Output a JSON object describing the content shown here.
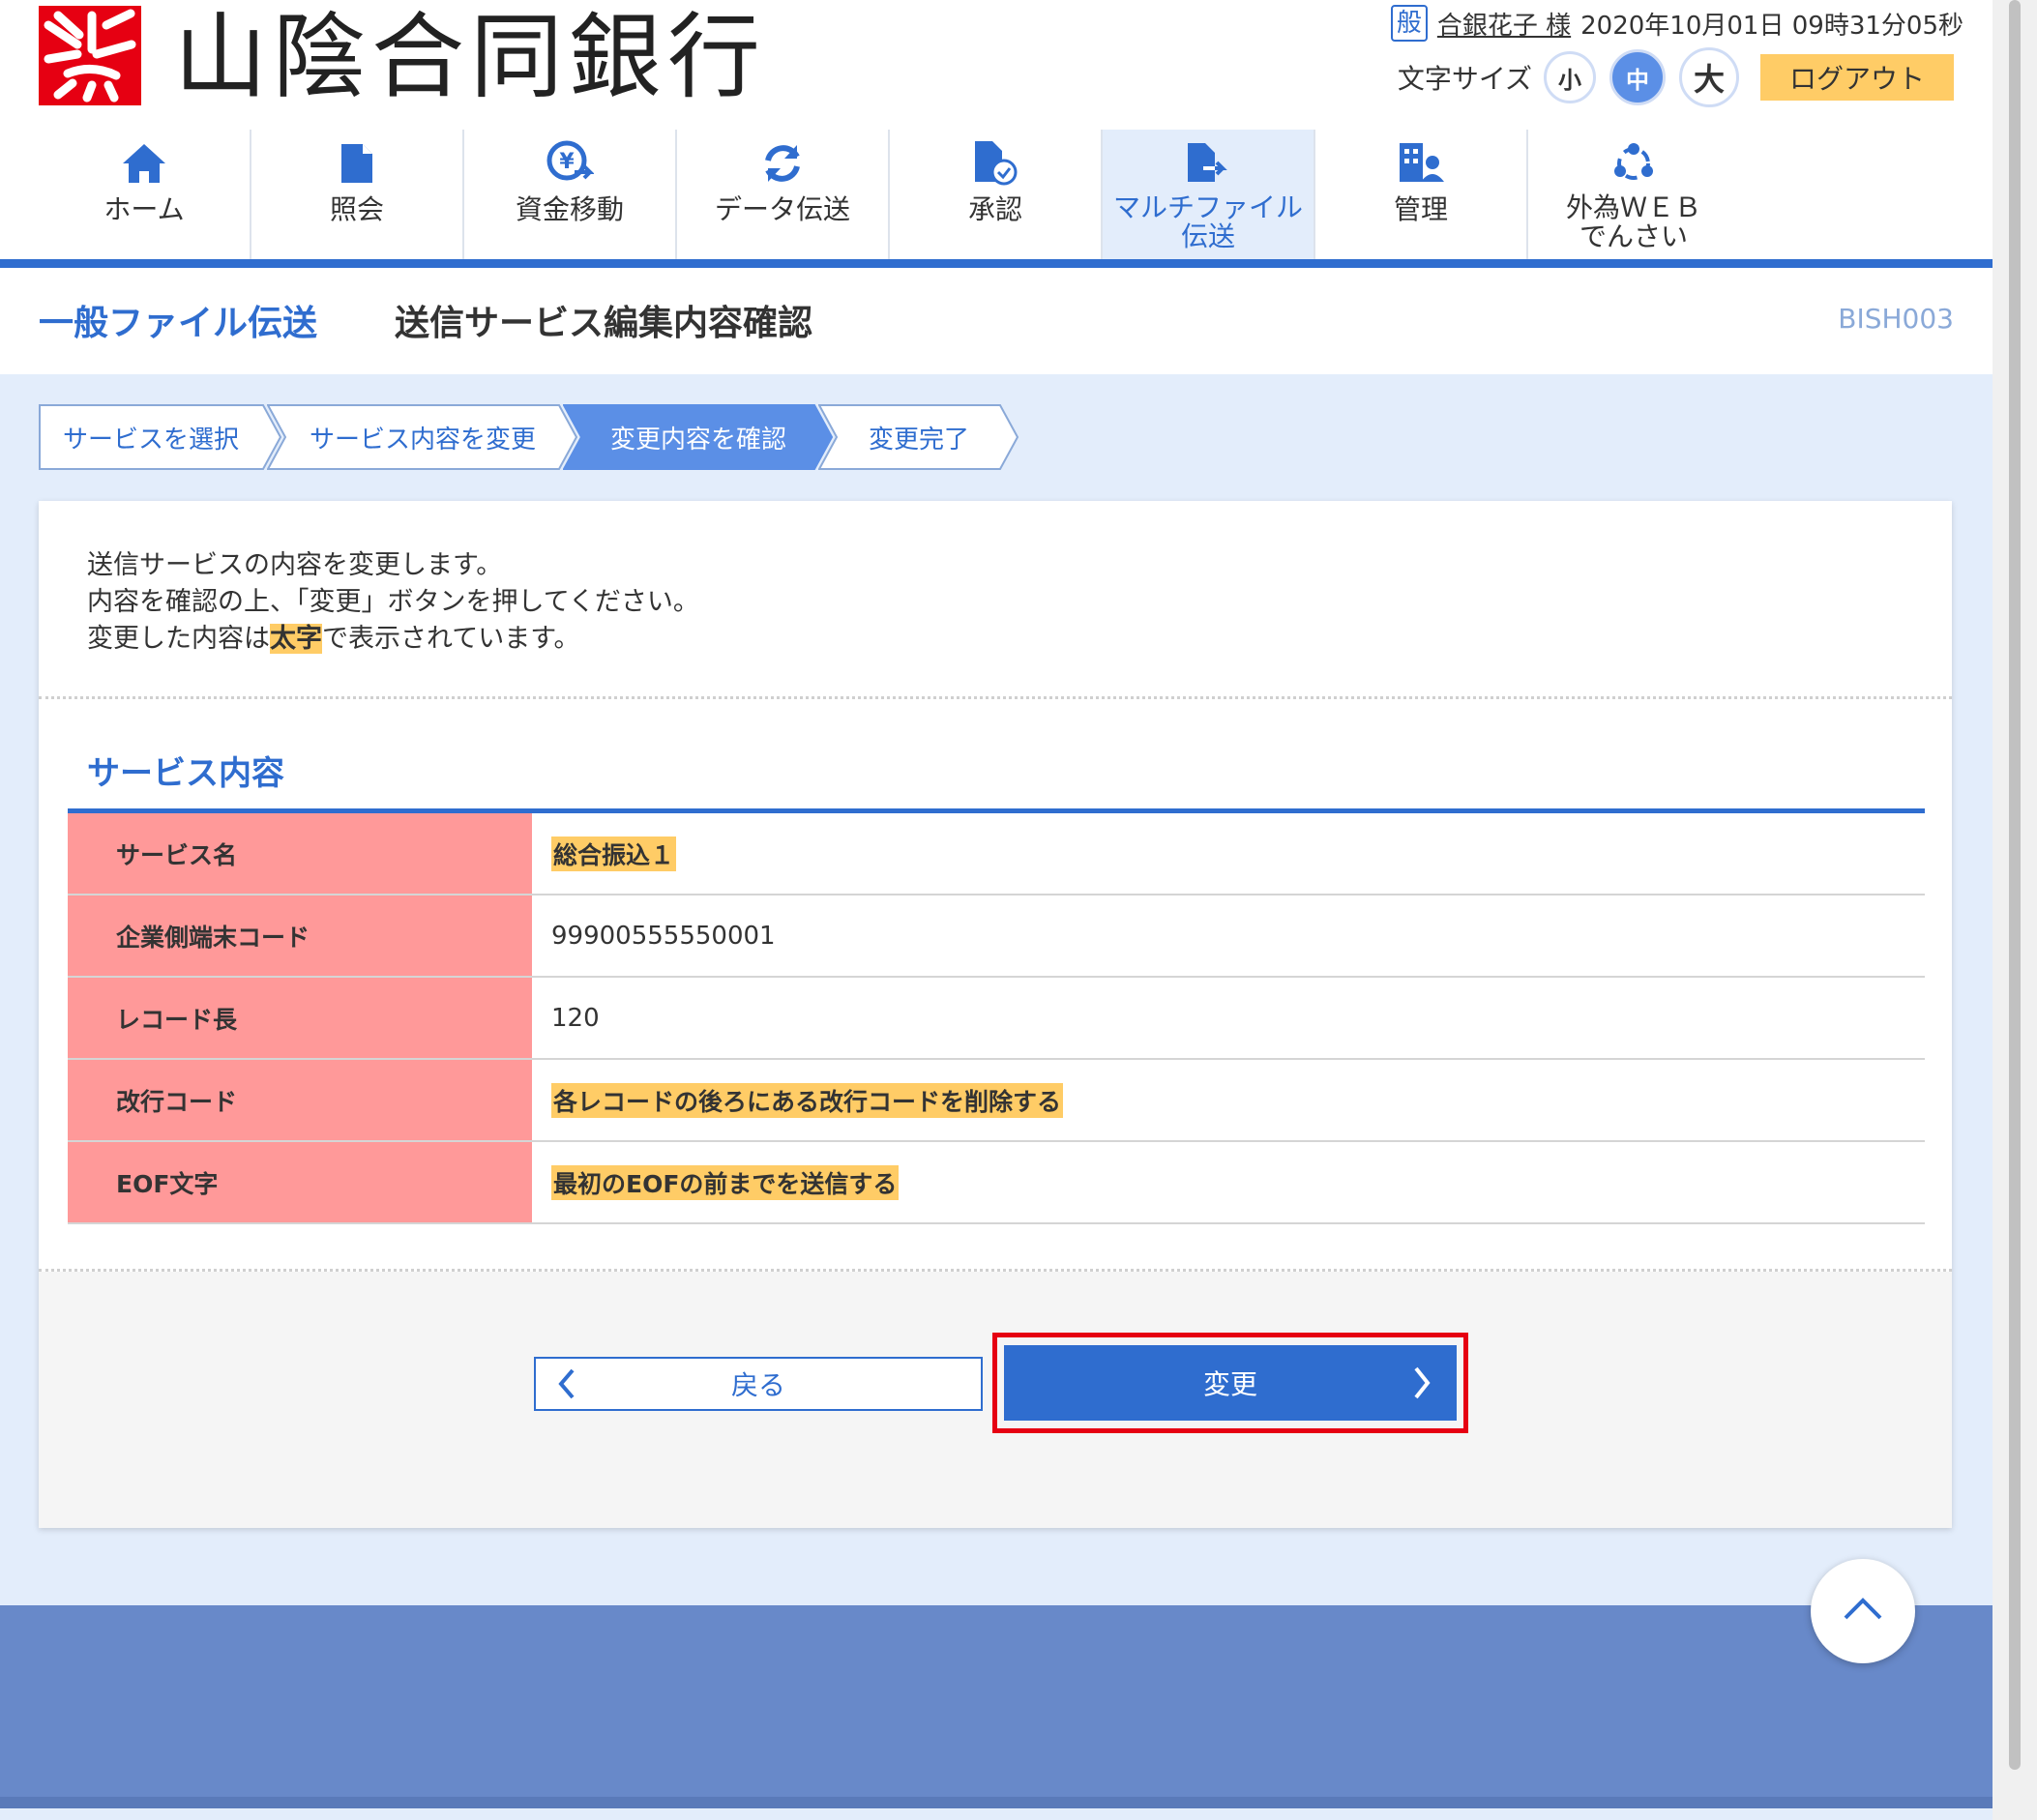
{
  "header": {
    "bank_name": "山陰合同銀行",
    "user_badge": "般",
    "user_name": "合銀花子 様",
    "datetime": "2020年10月01日 09時31分05秒",
    "font_size_label": "文字サイズ",
    "font_small": "小",
    "font_medium": "中",
    "font_large": "大",
    "logout": "ログアウト"
  },
  "nav": [
    {
      "label": "ホーム",
      "icon": "home-icon"
    },
    {
      "label": "照会",
      "icon": "document-icon"
    },
    {
      "label": "資金移動",
      "icon": "yen-transfer-icon"
    },
    {
      "label": "データ伝送",
      "icon": "sync-icon"
    },
    {
      "label": "承認",
      "icon": "approve-document-icon"
    },
    {
      "label": "マルチファイル伝送",
      "line1": "マルチファイル",
      "line2": "伝送",
      "icon": "file-transfer-icon",
      "active": true
    },
    {
      "label": "管理",
      "icon": "building-admin-icon"
    },
    {
      "label": "外為WEBでんさい",
      "line1": "外為ＷＥＢ",
      "line2": "でんさい",
      "icon": "network-icon"
    }
  ],
  "title": {
    "category": "一般ファイル伝送",
    "main": "送信サービス編集内容確認",
    "code": "BISH003"
  },
  "steps": [
    "サービスを選択",
    "サービス内容を変更",
    "変更内容を確認",
    "変更完了"
  ],
  "intro": {
    "line1": "送信サービスの内容を変更します。",
    "line2": "内容を確認の上、「変更」ボタンを押してください。",
    "line3_pre": "変更した内容は",
    "line3_hl": "太字",
    "line3_post": "で表示されています。"
  },
  "section_title": "サービス内容",
  "rows": [
    {
      "label": "サービス名",
      "value": "総合振込１",
      "changed": true
    },
    {
      "label": "企業側端末コード",
      "value": "99900555550001",
      "changed": false
    },
    {
      "label": "レコード長",
      "value": "120",
      "changed": false
    },
    {
      "label": "改行コード",
      "value": "各レコードの後ろにある改行コードを削除する",
      "changed": true
    },
    {
      "label": "EOF文字",
      "value": "最初のEOFの前までを送信する",
      "changed": true
    }
  ],
  "buttons": {
    "back": "戻る",
    "change": "変更"
  },
  "colors": {
    "primary": "#2f6dcf",
    "highlight": "#ffcc66",
    "table_header": "#ff9999",
    "outline": "#e60012"
  }
}
